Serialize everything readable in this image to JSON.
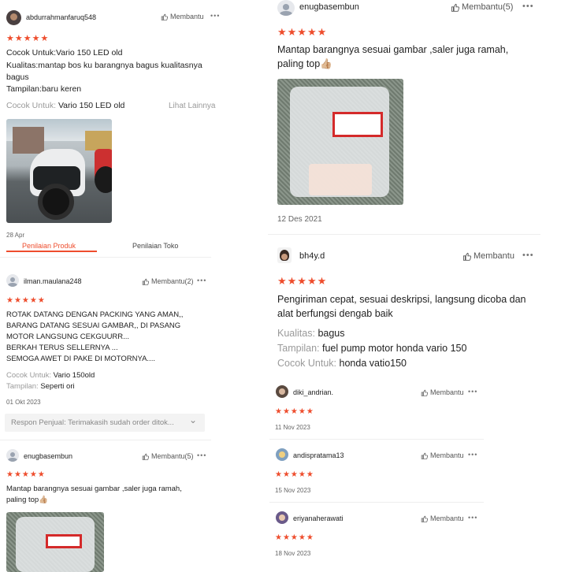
{
  "left": {
    "review1": {
      "username": "abdurrahmanfaruq548",
      "helpful_label": "Membantu",
      "more": "•••",
      "rating": "★★★★★",
      "line1": "Cocok Untuk:Vario 150 LED old",
      "line2": "Kualitas:mantap bos ku barangnya bagus kualitasnya",
      "line3": "bagus",
      "line4": "Tampilan:baru keren",
      "attr_key": "Cocok Untuk:",
      "attr_val": "Vario 150 LED old",
      "see_more": "Lihat Lainnya",
      "date": "28 Apr"
    },
    "tabs": [
      {
        "label": "Penilaian Produk"
      },
      {
        "label": "Penilaian Toko"
      }
    ],
    "review2": {
      "username": "ilman.maulana248",
      "helpful_label": "Membantu(2)",
      "more": "•••",
      "rating": "★★★★★",
      "lines": [
        "ROTAK DATANG DENGAN PACKING YANG AMAN,,",
        "BARANG DATANG SESUAI GAMBAR,, DI PASANG",
        "MOTOR LANGSUNG CEKGUURR...",
        "BERKAH TERUS SELLERNYA ...",
        "SEMOGA AWET DI PAKE DI MOTORNYA...."
      ],
      "attr1_key": "Cocok Untuk:",
      "attr1_val": "Vario 150old",
      "attr2_key": "Tampilan:",
      "attr2_val": "Seperti ori",
      "date": "01 Okt 2023",
      "seller_reply": "Respon Penjual: Terimakasih sudah order ditok...",
      "chevron": "⌄"
    },
    "review3": {
      "username": "enugbasembun",
      "helpful_label": "Membantu(5)",
      "more": "•••",
      "rating": "★★★★★",
      "line1": "Mantap barangnya sesuai  gambar ,saler juga ramah,",
      "line2": "paling top👍🏼"
    }
  },
  "right": {
    "review1": {
      "username": "enugbasembun",
      "helpful_label": "Membantu(5)",
      "more": "•••",
      "rating": "★★★★★",
      "line1": "Mantap barangnya sesuai  gambar ,saler juga ramah,",
      "line2": "paling top👍🏼",
      "date": "12 Des 2021"
    },
    "review2": {
      "username": "bh4y.d",
      "helpful_label": "Membantu",
      "more": "•••",
      "rating": "★★★★★",
      "line1": "Pengiriman cepat, sesuai deskripsi, langsung dicoba dan",
      "line2": "alat berfungsi dengab baik",
      "attr1_key": "Kualitas:",
      "attr1_val": "bagus",
      "attr2_key": "Tampilan:",
      "attr2_val": "fuel pump motor honda vario 150",
      "attr3_key": "Cocok Untuk:",
      "attr3_val": "honda vatio150"
    },
    "small_reviews": [
      {
        "username": "diki_andrian.",
        "helpful_label": "Membantu",
        "more": "•••",
        "rating": "★★★★★",
        "date": "11 Nov 2023"
      },
      {
        "username": "andispratama13",
        "helpful_label": "Membantu",
        "more": "•••",
        "rating": "★★★★★",
        "date": "15 Nov 2023"
      },
      {
        "username": "eriyanaherawati",
        "helpful_label": "Membantu",
        "more": "•••",
        "rating": "★★★★★",
        "date": "18 Nov 2023"
      }
    ]
  },
  "colors": {
    "star": "#ee4d2d",
    "accent": "#ee4d2d",
    "muted": "#9a9a9a"
  },
  "icons": [
    "thumbs-up-icon",
    "more-icon",
    "avatar-icon",
    "chevron-down-icon"
  ]
}
